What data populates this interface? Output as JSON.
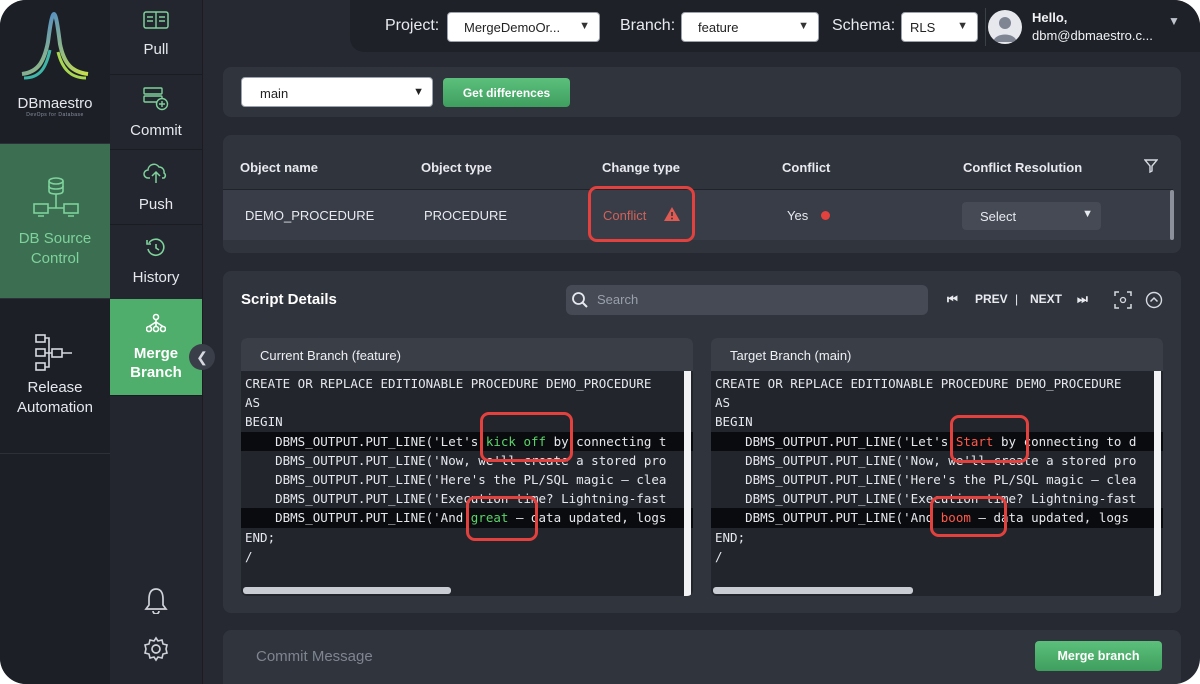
{
  "brand": {
    "name": "DBmaestro",
    "tagline": "DevOps for Database"
  },
  "main_nav": [
    {
      "label_line1": "DB Source",
      "label_line2": "Control",
      "icon": "database-icon",
      "active": true
    },
    {
      "label_line1": "Release",
      "label_line2": "Automation",
      "icon": "workflow-icon",
      "active": false
    }
  ],
  "sub_nav": [
    {
      "label": "Pull",
      "icon": "pull-icon"
    },
    {
      "label": "Commit",
      "icon": "commit-icon"
    },
    {
      "label": "Push",
      "icon": "cloud-upload-icon"
    },
    {
      "label": "History",
      "icon": "history-icon"
    },
    {
      "label_line1": "Merge",
      "label_line2": "Branch",
      "icon": "merge-icon",
      "active": true
    }
  ],
  "topbar": {
    "project_label": "Project:",
    "project_value": "MergeDemoOr...",
    "branch_label": "Branch:",
    "branch_value": "feature",
    "schema_label": "Schema:",
    "schema_value": "RLS",
    "hello": "Hello,",
    "email": "dbm@dbmaestro.c..."
  },
  "compare": {
    "branch_value": "main",
    "get_diff_label": "Get differences"
  },
  "table": {
    "headers": [
      "Object name",
      "Object type",
      "Change type",
      "Conflict",
      "Conflict Resolution"
    ],
    "rows": [
      {
        "object_name": "DEMO_PROCEDURE",
        "object_type": "PROCEDURE",
        "change_type": "Conflict",
        "conflict": "Yes",
        "resolution": "Select"
      }
    ]
  },
  "script_details": {
    "title": "Script Details",
    "search_placeholder": "Search",
    "prev_label": "PREV",
    "sep": "|",
    "next_label": "NEXT",
    "current": {
      "header": "Current Branch (feature)",
      "lines": [
        {
          "text": "CREATE OR REPLACE EDITIONABLE PROCEDURE DEMO_PROCEDURE",
          "hl": false
        },
        {
          "text": "AS",
          "hl": false
        },
        {
          "text": "BEGIN",
          "hl": false
        },
        {
          "pre": "    DBMS_OUTPUT.PUT_LINE('Let's ",
          "diff": "kick off",
          "post": " by connecting t",
          "hl": true
        },
        {
          "text": "    DBMS_OUTPUT.PUT_LINE('Now, we'll create a stored pro",
          "hl": false
        },
        {
          "text": "    DBMS_OUTPUT.PUT_LINE('Here's the PL/SQL magic — clea",
          "hl": false
        },
        {
          "text": "    DBMS_OUTPUT.PUT_LINE('Execution time? Lightning-fast",
          "hl": false
        },
        {
          "pre": "    DBMS_OUTPUT.PUT_LINE('And ",
          "diff": "great",
          "post": " — data updated, logs",
          "hl": true
        },
        {
          "text": "END;",
          "hl": false
        },
        {
          "text": "/",
          "hl": false
        }
      ]
    },
    "target": {
      "header": "Target Branch (main)",
      "lines": [
        {
          "text": "CREATE OR REPLACE EDITIONABLE PROCEDURE DEMO_PROCEDURE",
          "hl": false
        },
        {
          "text": "AS",
          "hl": false
        },
        {
          "text": "BEGIN",
          "hl": false
        },
        {
          "pre": "    DBMS_OUTPUT.PUT_LINE('Let's ",
          "diff": "Start",
          "post": " by connecting to d",
          "hl": true
        },
        {
          "text": "    DBMS_OUTPUT.PUT_LINE('Now, we'll create a stored pro",
          "hl": false
        },
        {
          "text": "    DBMS_OUTPUT.PUT_LINE('Here's the PL/SQL magic — clea",
          "hl": false
        },
        {
          "text": "    DBMS_OUTPUT.PUT_LINE('Execution time? Lightning-fast",
          "hl": false
        },
        {
          "pre": "    DBMS_OUTPUT.PUT_LINE('And ",
          "diff": "boom",
          "post": " — data updated, logs",
          "hl": true
        },
        {
          "text": "END;",
          "hl": false
        },
        {
          "text": "/",
          "hl": false
        }
      ]
    }
  },
  "commit": {
    "placeholder": "Commit Message",
    "merge_label": "Merge branch"
  },
  "colors": {
    "accent": "#4fae6b",
    "conflict": "#d0625a",
    "annotation": "#e2413e",
    "diff_current": "#5bd46a",
    "diff_target": "#ff5a4a"
  }
}
